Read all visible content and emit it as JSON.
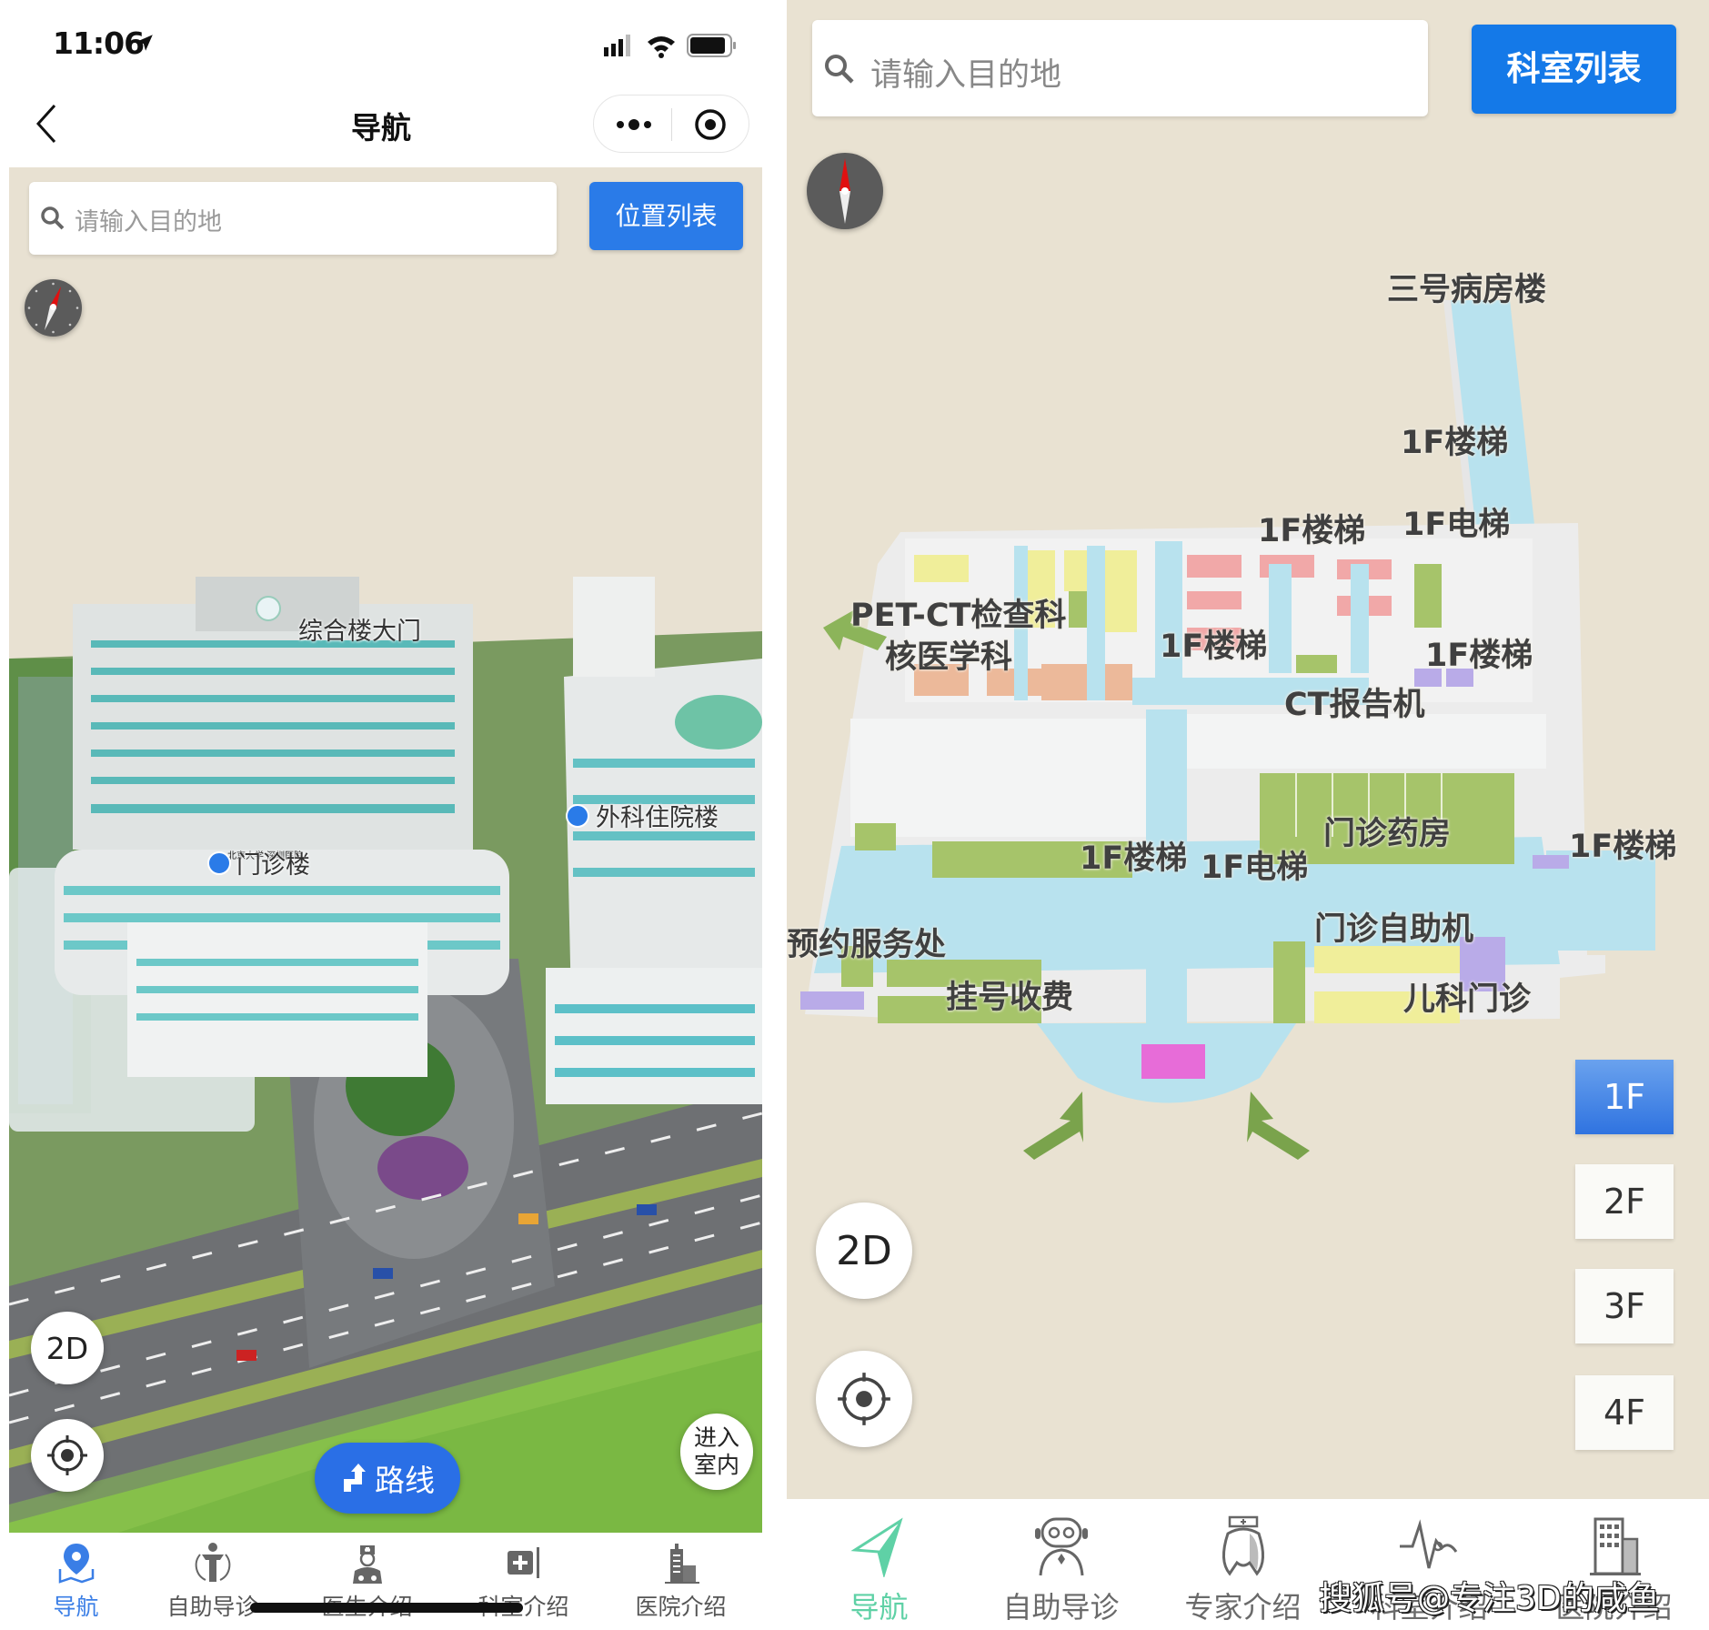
{
  "left_phone": {
    "status_bar": {
      "time": "11:06"
    },
    "nav_bar": {
      "title": "导航"
    },
    "search": {
      "placeholder": "请输入目的地",
      "list_button": "位置列表"
    },
    "map_labels": {
      "building_1": "综合楼大门",
      "building_2": "门诊楼",
      "building_3": "外科住院楼",
      "facade_sign": "北京大学 深圳医院"
    },
    "controls": {
      "view_mode": "2D",
      "route": "路线",
      "indoor_line1": "进入",
      "indoor_line2": "室内"
    },
    "tabs": [
      {
        "label": "导航",
        "icon": "map-pin-icon",
        "active": true
      },
      {
        "label": "自助导诊",
        "icon": "self-guide-icon",
        "active": false
      },
      {
        "label": "医生介绍",
        "icon": "doctor-icon",
        "active": false
      },
      {
        "label": "科室介绍",
        "icon": "department-icon",
        "active": false
      },
      {
        "label": "医院介绍",
        "icon": "hospital-icon",
        "active": false
      }
    ]
  },
  "right_panel": {
    "search": {
      "placeholder": "请输入目的地",
      "list_button": "科室列表"
    },
    "floor_labels": {
      "ward3": "三号病房楼",
      "stairs_a": "1F楼梯",
      "stairs_b": "1F楼梯",
      "elevator_a": "1F电梯",
      "pet_ct": "PET-CT检查科",
      "nuclear": "核医学科",
      "stairs_c": "1F楼梯",
      "stairs_d": "1F楼梯",
      "ct_report": "CT报告机",
      "pharmacy": "门诊药房",
      "stairs_e": "1F楼梯",
      "elevator_b": "1F电梯",
      "stairs_f": "1F楼梯",
      "appointment": "预约服务处",
      "self_service": "门诊自助机",
      "registration": "挂号收费",
      "pediatrics": "儿科门诊"
    },
    "controls": {
      "view_mode": "2D"
    },
    "floors": [
      {
        "label": "1F",
        "active": true
      },
      {
        "label": "2F",
        "active": false
      },
      {
        "label": "3F",
        "active": false
      },
      {
        "label": "4F",
        "active": false
      }
    ],
    "tabs": [
      {
        "label": "导航",
        "icon": "navigation-arrow-icon",
        "active": true
      },
      {
        "label": "自助导诊",
        "icon": "robot-icon",
        "active": false
      },
      {
        "label": "专家介绍",
        "icon": "expert-icon",
        "active": false
      },
      {
        "label": "科室介绍",
        "icon": "heartbeat-icon",
        "active": false
      },
      {
        "label": "医院介绍",
        "icon": "building-icon",
        "active": false
      }
    ],
    "watermark": "搜狐号@专注3D的咸鱼"
  },
  "colors": {
    "accent_blue": "#2a7be8",
    "map_bg": "#e9e2d2",
    "corridor": "#b8e2ee",
    "room_green": "#a6c46a",
    "room_yellow": "#f0ee9a",
    "room_pink": "#f1a8a8",
    "room_orange": "#ecb99a",
    "room_purple": "#b9abe8",
    "active_tab_green": "#5fd1a6"
  }
}
